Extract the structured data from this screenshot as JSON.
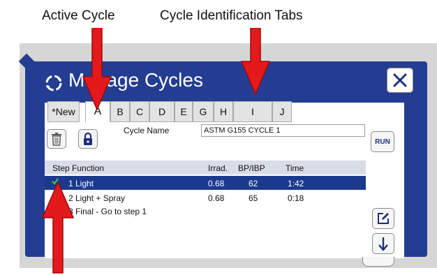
{
  "annotations": {
    "active_cycle": "Active Cycle",
    "cycle_tabs": "Cycle Identification Tabs"
  },
  "dialog": {
    "title": "Manage Cycles",
    "close_icon": "close-icon"
  },
  "tabs": [
    {
      "label": "*New",
      "active": false
    },
    {
      "label": "A",
      "active": true
    },
    {
      "label": "B",
      "active": false
    },
    {
      "label": "C",
      "active": false
    },
    {
      "label": "D",
      "active": false
    },
    {
      "label": "E",
      "active": false
    },
    {
      "label": "G",
      "active": false
    },
    {
      "label": "H",
      "active": false
    },
    {
      "label": "I",
      "active": false
    },
    {
      "label": "J",
      "active": false
    }
  ],
  "toolbar": {
    "trash_icon": "trash-icon",
    "lock_icon": "lock-icon",
    "cycle_name_label": "Cycle Name",
    "cycle_name_value": "ASTM G155 CYCLE 1",
    "run_label": "RUN"
  },
  "table": {
    "headers": {
      "step_function": "Step Function",
      "irrad": "Irrad.",
      "bp_ibp": "BP/IBP",
      "time": "Time"
    },
    "rows": [
      {
        "step": "1 Light",
        "irrad": "0.68",
        "bp": "62",
        "time": "1:42",
        "selected": true
      },
      {
        "step": "2 Light + Spray",
        "irrad": "0.68",
        "bp": "65",
        "time": "0:18",
        "selected": false
      },
      {
        "step": "3 Final - Go to step 1",
        "irrad": "",
        "bp": "",
        "time": "",
        "selected": false
      }
    ]
  },
  "side_buttons": {
    "edit_icon": "edit-icon",
    "down_icon": "arrow-down-icon"
  },
  "colors": {
    "frame": "#233d92",
    "selected_row": "#1c3a8d",
    "annotation_arrow": "#e4191c"
  }
}
